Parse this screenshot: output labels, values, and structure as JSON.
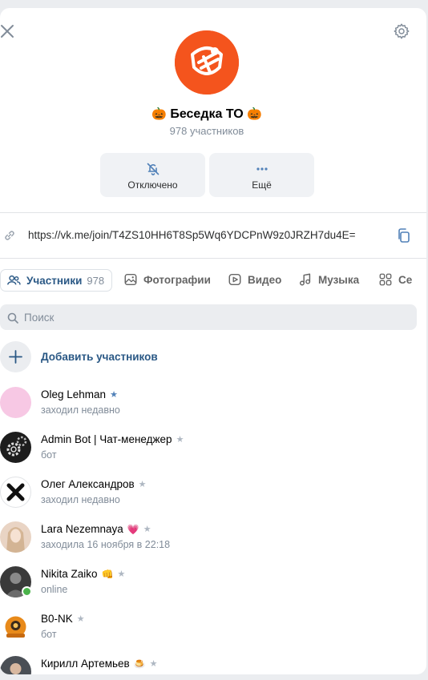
{
  "header": {
    "title_prefix_emoji": "🎃",
    "title": "Беседка ТО",
    "title_suffix_emoji": "🎃",
    "subtitle": "978 участников"
  },
  "actions": [
    {
      "label": "Отключено",
      "icon": "bell-off-icon"
    },
    {
      "label": "Ещё",
      "icon": "more-dots-icon"
    }
  ],
  "invite_link": "https://vk.me/join/T4ZS10HH6T8Sp5Wq6YDCPnW9z0JRZH7du4E=",
  "tabs": [
    {
      "label": "Участники",
      "count": "978",
      "icon": "users-icon"
    },
    {
      "label": "Фотографии",
      "icon": "photo-icon"
    },
    {
      "label": "Видео",
      "icon": "video-icon"
    },
    {
      "label": "Музыка",
      "icon": "music-icon"
    },
    {
      "label": "Се",
      "icon": "services-icon"
    }
  ],
  "search": {
    "placeholder": "Поиск",
    "value": ""
  },
  "add_members_label": "Добавить участников",
  "members": [
    {
      "name": "Oleg Lehman",
      "emoji": "",
      "star": "★",
      "star_color": "#5181b8",
      "status": "заходил недавно"
    },
    {
      "name": "Admin Bot | Чат-менеджер",
      "emoji": "",
      "star": "★",
      "star_color": "#aeb7c2",
      "status": "бот"
    },
    {
      "name": "Олег Александров",
      "emoji": "",
      "star": "★",
      "star_color": "#aeb7c2",
      "status": "заходил недавно"
    },
    {
      "name": "Lara Nezemnaya",
      "emoji": "💗",
      "star": "★",
      "star_color": "#aeb7c2",
      "status": "заходила 16 ноября в 22:18"
    },
    {
      "name": "Nikita Zaiko",
      "emoji": "👊",
      "star": "★",
      "star_color": "#aeb7c2",
      "status": "online"
    },
    {
      "name": "B0-NK",
      "emoji": "",
      "star": "★",
      "star_color": "#aeb7c2",
      "status": "бот"
    },
    {
      "name": "Кирилл Артемьев",
      "emoji": "🍮",
      "star": "★",
      "star_color": "#aeb7c2",
      "status": ""
    }
  ],
  "colors": {
    "accent": "#2a5885",
    "secondary_text": "#818c99",
    "online": "#4bb34b",
    "avatar_brand": "#f4541d"
  }
}
